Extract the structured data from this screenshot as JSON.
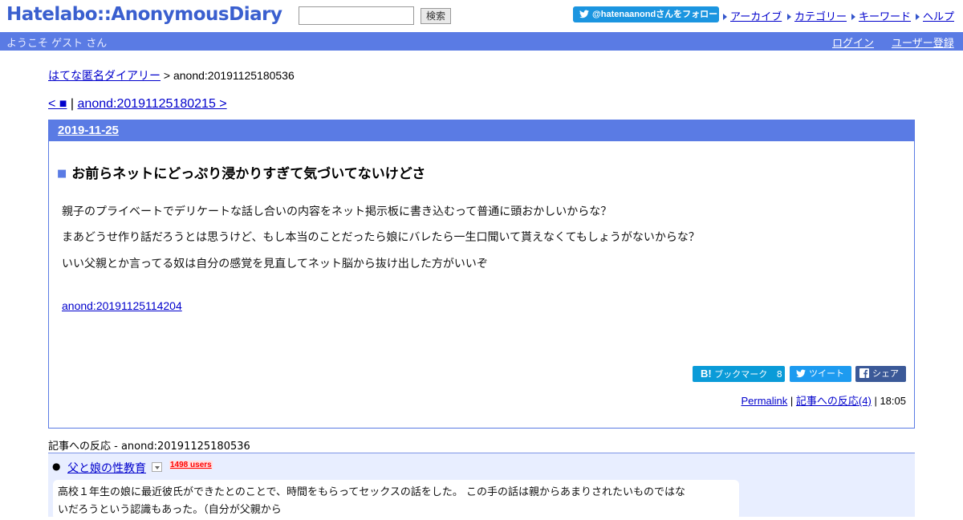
{
  "header": {
    "logo": "Hatelabo::AnonymousDiary",
    "search_value": "",
    "search_button": "検索",
    "follow_button": "@hatenaanondさんをフォロー",
    "nav": [
      "アーカイブ",
      "カテゴリー",
      "キーワード",
      "ヘルプ"
    ]
  },
  "welcome_bar": {
    "welcome": "ようこそ ゲスト さん",
    "login": "ログイン",
    "register": "ユーザー登録"
  },
  "breadcrumb": {
    "home": "はてな匿名ダイアリー",
    "separator": ">",
    "current": "anond:20191125180536"
  },
  "pager": {
    "prev": "< ■",
    "separator": "|",
    "next": "anond:20191125180215 >"
  },
  "entry": {
    "date": "2019-11-25",
    "marker": "■",
    "title": "お前らネットにどっぷり浸かりすぎて気づいてないけどさ",
    "body": [
      "親子のプライベートでデリケートな話し合いの内容をネット掲示板に書き込むって普通に頭おかしいからな？",
      "まあどうせ作り話だろうとは思うけど、もし本当のことだったら娘にバレたら一生口聞いて貰えなくてもしょうがないからな？",
      "いい父親とか言ってる奴は自分の感覚を見直してネット脳から抜け出した方がいいぞ"
    ],
    "reference_link": "anond:20191125114204",
    "share": {
      "hatena_bookmark": "ブックマーク",
      "hatena_count": "8",
      "tweet": "ツイート",
      "facebook": "シェア"
    },
    "footer": {
      "permalink": "Permalink",
      "separator": "|",
      "reactions_link": "記事への反応(4)",
      "time": "18:05"
    }
  },
  "reactions": {
    "heading": "記事への反応 - anond:20191125180536",
    "items": [
      {
        "title": "父と娘の性教育",
        "users": "1498 users",
        "snippet_1": "高校１年生の娘に最近彼氏ができたとのことで、時間をもらってセックスの話をした。 この手の話は親からあまりされたいものではな",
        "snippet_2": "いだろうという認識もあった。（自分が父親から"
      }
    ]
  },
  "colors": {
    "accent": "#5a7be4",
    "link": "#0000cc",
    "reaction_bg": "#e8eeff",
    "users_badge": "#ff0000"
  }
}
